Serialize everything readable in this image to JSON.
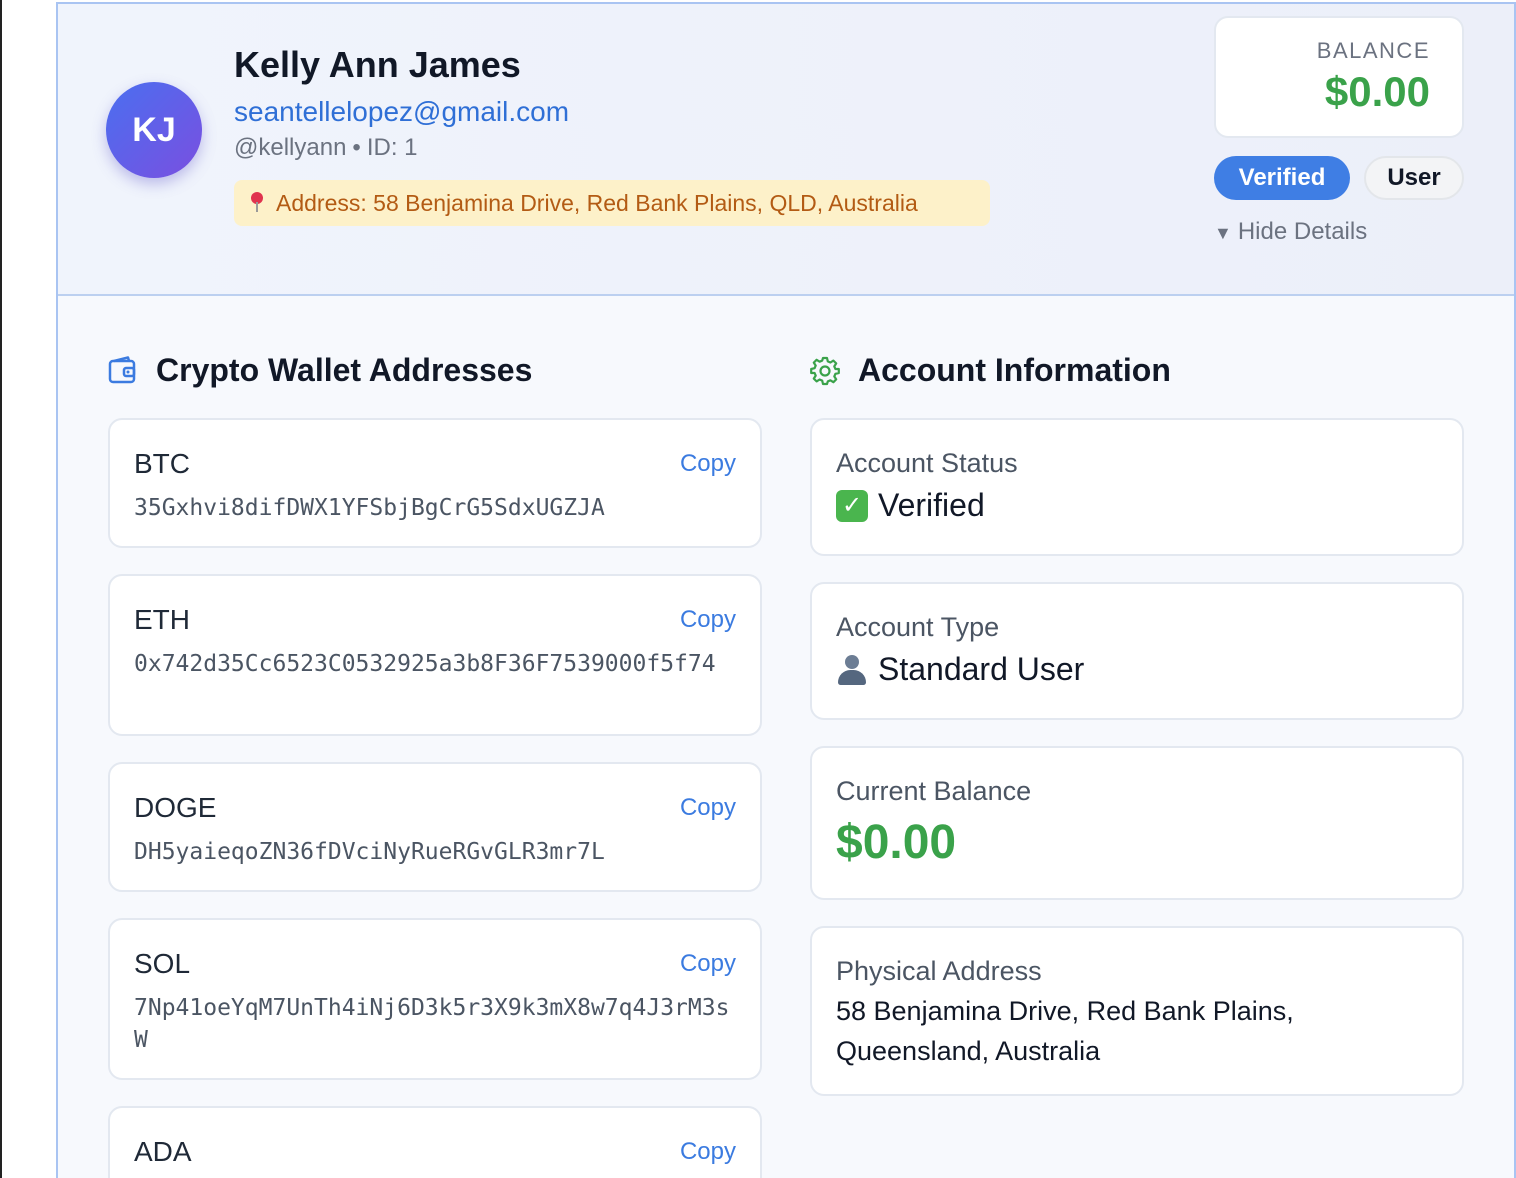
{
  "profile": {
    "initials": "KJ",
    "name": "Kelly Ann James",
    "email": "seantellelopez@gmail.com",
    "username": "@kellyann",
    "id_label": "ID: 1",
    "address_pill": "Address: 58 Benjamina Drive, Red Bank Plains, QLD, Australia"
  },
  "balance": {
    "label": "BALANCE",
    "value": "$0.00"
  },
  "badges": {
    "verified": "Verified",
    "role": "User"
  },
  "toggle": {
    "icon": "▼",
    "label": "Hide Details"
  },
  "wallets": {
    "title": "Crypto Wallet Addresses",
    "copy_label": "Copy",
    "items": [
      {
        "coin": "BTC",
        "address": "35Gxhvi8difDWX1YFSbjBgCrG5SdxUGZJA"
      },
      {
        "coin": "ETH",
        "address": "0x742d35Cc6523C0532925a3b8F36F7539000f5f74"
      },
      {
        "coin": "DOGE",
        "address": "DH5yaieqoZN36fDVciNyRueRGvGLR3mr7L"
      },
      {
        "coin": "SOL",
        "address": "7Np41oeYqM7UnTh4iNj6D3k5r3X9k3mX8w7q4J3rM3sW"
      },
      {
        "coin": "ADA",
        "address": ""
      }
    ]
  },
  "account": {
    "title": "Account Information",
    "status_label": "Account Status",
    "status_value": "Verified",
    "type_label": "Account Type",
    "type_value": "Standard User",
    "balance_label": "Current Balance",
    "balance_value": "$0.00",
    "address_label": "Physical Address",
    "address_value": "58 Benjamina Drive, Red Bank Plains, Queensland, Australia"
  },
  "colors": {
    "accent": "#3f7ee4",
    "success": "#3aa24a",
    "link": "#2f6fd6",
    "warning_bg": "#fdf1c9",
    "warning_text": "#b35b14"
  },
  "icons": {
    "wallet": "wallet-icon",
    "settings": "gear-icon",
    "location": "pin-icon",
    "verified": "check-icon",
    "user": "person-icon"
  }
}
